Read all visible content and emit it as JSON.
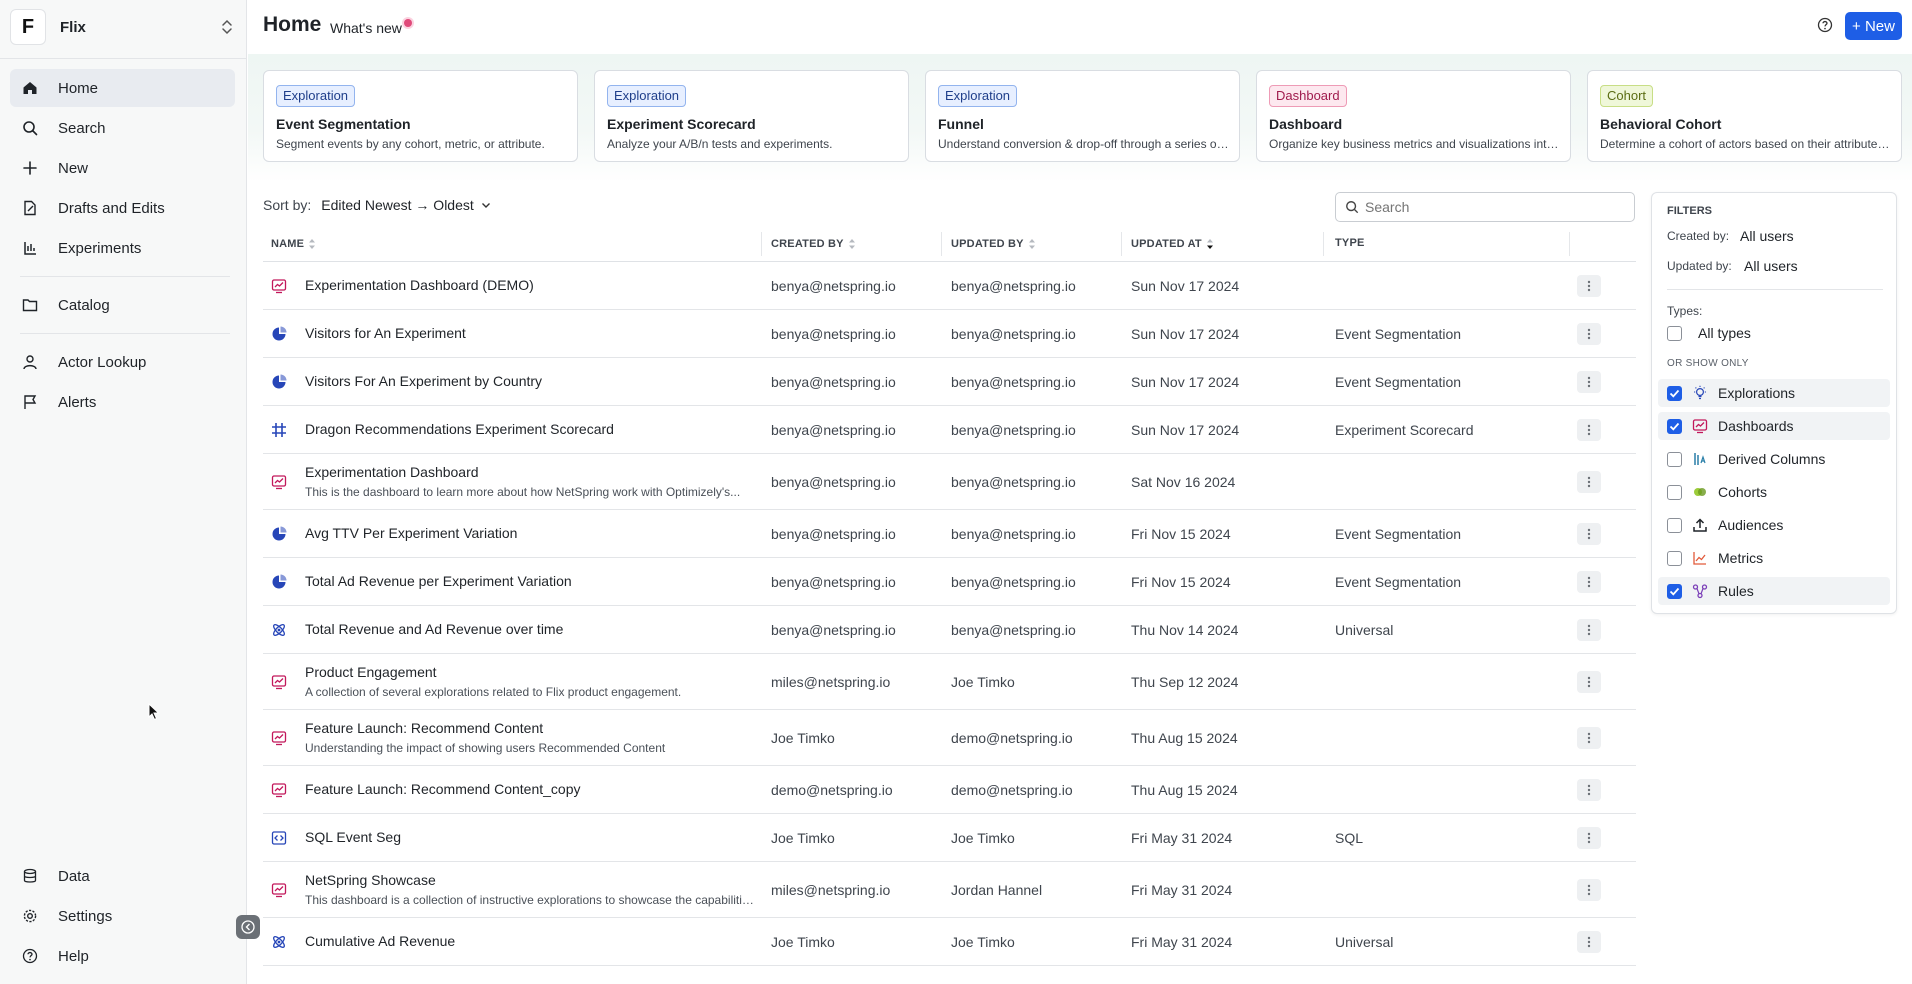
{
  "workspace": {
    "initial": "F",
    "name": "Flix"
  },
  "nav": {
    "top": [
      {
        "label": "Home",
        "icon": "home-icon"
      },
      {
        "label": "Search",
        "icon": "search-icon"
      },
      {
        "label": "New",
        "icon": "plus-icon"
      },
      {
        "label": "Drafts and Edits",
        "icon": "drafts-icon"
      },
      {
        "label": "Experiments",
        "icon": "experiments-icon"
      }
    ],
    "catalog": {
      "label": "Catalog",
      "icon": "folder-icon"
    },
    "mid": [
      {
        "label": "Actor Lookup",
        "icon": "person-icon"
      },
      {
        "label": "Alerts",
        "icon": "flag-icon"
      }
    ],
    "bottom": [
      {
        "label": "Data",
        "icon": "database-icon"
      },
      {
        "label": "Settings",
        "icon": "gear-icon"
      },
      {
        "label": "Help",
        "icon": "question-icon"
      }
    ]
  },
  "header": {
    "title": "Home",
    "whats_new": "What's new",
    "new_button": "+ New"
  },
  "templates": [
    {
      "badge": "Exploration",
      "kind": "exp",
      "title": "Event Segmentation",
      "desc": "Segment events by any cohort, metric, or attribute."
    },
    {
      "badge": "Exploration",
      "kind": "exp",
      "title": "Experiment Scorecard",
      "desc": "Analyze your A/B/n tests and experiments."
    },
    {
      "badge": "Exploration",
      "kind": "exp",
      "title": "Funnel",
      "desc": "Understand conversion & drop-off through a series of ..."
    },
    {
      "badge": "Dashboard",
      "kind": "dash",
      "title": "Dashboard",
      "desc": "Organize key business metrics and visualizations into i..."
    },
    {
      "badge": "Cohort",
      "kind": "coh",
      "title": "Behavioral Cohort",
      "desc": "Determine a cohort of actors based on their attributes ..."
    }
  ],
  "toolbar": {
    "sort_label": "Sort by:",
    "sort_value": "Edited Newest → Oldest",
    "search_placeholder": "Search"
  },
  "table": {
    "columns": [
      "NAME",
      "CREATED BY",
      "UPDATED BY",
      "UPDATED AT",
      "TYPE"
    ],
    "rows": [
      {
        "name": "Experimentation Dashboard (DEMO)",
        "desc": "",
        "icon": "dashboard",
        "created_by": "benya@netspring.io",
        "updated_by": "benya@netspring.io",
        "updated_at": "Sun Nov 17 2024",
        "type": ""
      },
      {
        "name": "Visitors for An Experiment",
        "desc": "",
        "icon": "segmentation",
        "created_by": "benya@netspring.io",
        "updated_by": "benya@netspring.io",
        "updated_at": "Sun Nov 17 2024",
        "type": "Event Segmentation"
      },
      {
        "name": "Visitors For An Experiment by Country",
        "desc": "",
        "icon": "segmentation",
        "created_by": "benya@netspring.io",
        "updated_by": "benya@netspring.io",
        "updated_at": "Sun Nov 17 2024",
        "type": "Event Segmentation"
      },
      {
        "name": "Dragon Recommendations Experiment Scorecard",
        "desc": "",
        "icon": "scorecard",
        "created_by": "benya@netspring.io",
        "updated_by": "benya@netspring.io",
        "updated_at": "Sun Nov 17 2024",
        "type": "Experiment Scorecard"
      },
      {
        "name": "Experimentation Dashboard",
        "desc": "This is the dashboard to learn more about how NetSpring work with Optimizely's...",
        "icon": "dashboard",
        "created_by": "benya@netspring.io",
        "updated_by": "benya@netspring.io",
        "updated_at": "Sat Nov 16 2024",
        "type": ""
      },
      {
        "name": "Avg TTV Per Experiment Variation",
        "desc": "",
        "icon": "segmentation",
        "created_by": "benya@netspring.io",
        "updated_by": "benya@netspring.io",
        "updated_at": "Fri Nov 15 2024",
        "type": "Event Segmentation"
      },
      {
        "name": "Total Ad Revenue per Experiment Variation",
        "desc": "",
        "icon": "segmentation",
        "created_by": "benya@netspring.io",
        "updated_by": "benya@netspring.io",
        "updated_at": "Fri Nov 15 2024",
        "type": "Event Segmentation"
      },
      {
        "name": "Total Revenue and Ad Revenue over time",
        "desc": "",
        "icon": "universal",
        "created_by": "benya@netspring.io",
        "updated_by": "benya@netspring.io",
        "updated_at": "Thu Nov 14 2024",
        "type": "Universal"
      },
      {
        "name": "Product Engagement",
        "desc": "A collection of several explorations related to Flix product engagement.",
        "icon": "dashboard",
        "created_by": "miles@netspring.io",
        "updated_by": "Joe Timko",
        "updated_at": "Thu Sep 12 2024",
        "type": ""
      },
      {
        "name": "Feature Launch: Recommend Content",
        "desc": "Understanding the impact of showing users Recommended Content",
        "icon": "dashboard",
        "created_by": "Joe Timko",
        "updated_by": "demo@netspring.io",
        "updated_at": "Thu Aug 15 2024",
        "type": ""
      },
      {
        "name": "Feature Launch: Recommend Content_copy",
        "desc": "",
        "icon": "dashboard",
        "created_by": "demo@netspring.io",
        "updated_by": "demo@netspring.io",
        "updated_at": "Thu Aug 15 2024",
        "type": ""
      },
      {
        "name": "SQL Event Seg",
        "desc": "",
        "icon": "sql",
        "created_by": "Joe Timko",
        "updated_by": "Joe Timko",
        "updated_at": "Fri May 31 2024",
        "type": "SQL"
      },
      {
        "name": "NetSpring Showcase",
        "desc": "This dashboard is a collection of instructive explorations to showcase the capabilities ...",
        "icon": "dashboard",
        "created_by": "miles@netspring.io",
        "updated_by": "Jordan Hannel",
        "updated_at": "Fri May 31 2024",
        "type": ""
      },
      {
        "name": "Cumulative Ad Revenue",
        "desc": "",
        "icon": "universal",
        "created_by": "Joe Timko",
        "updated_by": "Joe Timko",
        "updated_at": "Fri May 31 2024",
        "type": "Universal"
      }
    ]
  },
  "filters": {
    "title": "FILTERS",
    "created_by_label": "Created by:",
    "created_by_value": "All users",
    "updated_by_label": "Updated by:",
    "updated_by_value": "All users",
    "types_label": "Types:",
    "all_types": "All types",
    "or_show_only": "OR SHOW ONLY",
    "items": [
      {
        "label": "Explorations",
        "checked": true,
        "icon": "bulb-icon"
      },
      {
        "label": "Dashboards",
        "checked": true,
        "icon": "dashboard-icon"
      },
      {
        "label": "Derived Columns",
        "checked": false,
        "icon": "derived-column-icon"
      },
      {
        "label": "Cohorts",
        "checked": false,
        "icon": "cohort-icon"
      },
      {
        "label": "Audiences",
        "checked": false,
        "icon": "upload-icon"
      },
      {
        "label": "Metrics",
        "checked": false,
        "icon": "metric-icon"
      },
      {
        "label": "Rules",
        "checked": true,
        "icon": "rules-icon"
      }
    ]
  },
  "colors": {
    "accent": "#1e5ee6",
    "dashboard_icon": "#c2185b",
    "exploration_icon": "#2746b8"
  }
}
